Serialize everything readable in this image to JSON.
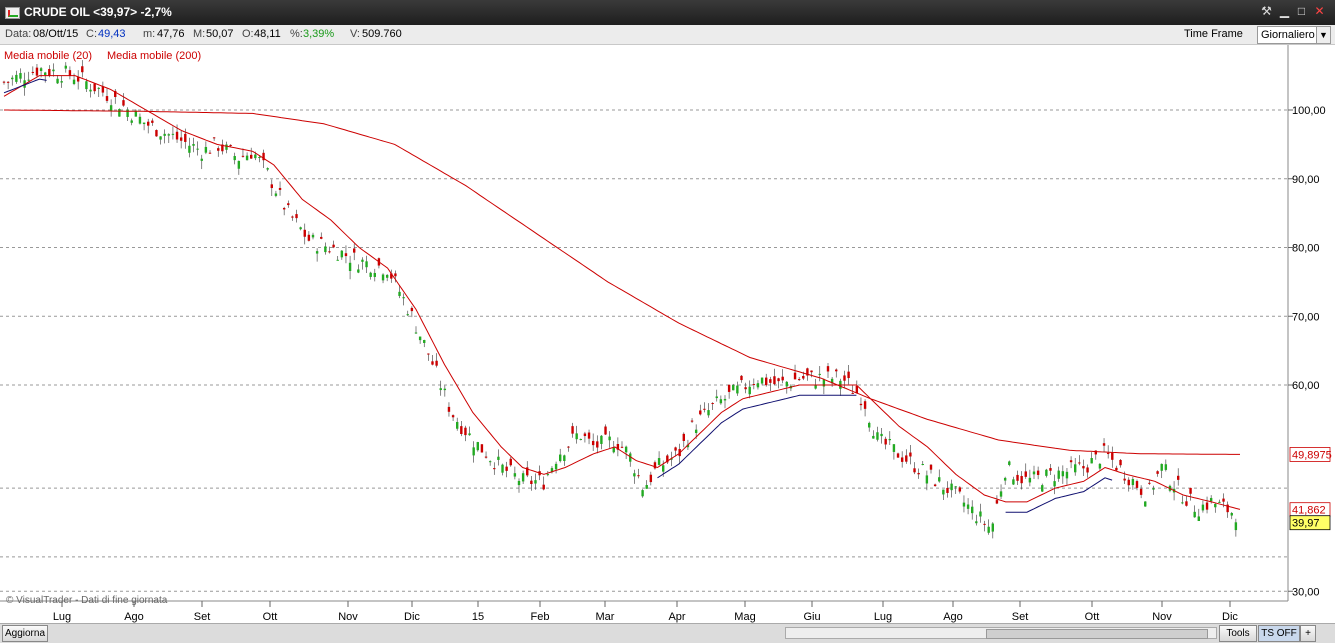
{
  "window": {
    "title": "CRUDE OIL <39,97> -2,7%",
    "controls": {
      "tools": "⚒",
      "minimize": "▁",
      "maximize": "□",
      "close": "✕"
    }
  },
  "infobar": {
    "date_label": "Data:",
    "date": "08/Ott/15",
    "close_label": "C:",
    "close": "49,43",
    "min_label": "m:",
    "min": "47,76",
    "max_label": "M:",
    "max": "50,07",
    "open_label": "O:",
    "open": "48,11",
    "pct_label": "%:",
    "pct": "3,39%",
    "vol_label": "V:",
    "vol": "509.760",
    "timeframe_label": "Time Frame",
    "timeframe_value": "Giornaliero"
  },
  "legend": {
    "ma20": "Media mobile (20)",
    "ma200": "Media mobile (200)"
  },
  "watermark": "© VisualTrader - Dati di fine giornata",
  "price_badges": {
    "ma200": "49,8975",
    "ma20": "41,862",
    "last": "39,97"
  },
  "colors": {
    "ma20": "#cc0000",
    "ma200": "#cc0000",
    "up": "#22aa22",
    "down": "#cc0000",
    "last_badge": "#ffff66"
  },
  "bottombar": {
    "update": "Aggiorna",
    "tools": "Tools",
    "ts": "TS OFF",
    "plus": "+"
  },
  "chart_data": {
    "type": "candlestick",
    "y_ticks": [
      "100,00",
      "90,00",
      "80,00",
      "70,00",
      "60,00",
      "30,00"
    ],
    "x_labels": [
      "Lug",
      "Ago",
      "Set",
      "Ott",
      "Nov",
      "Dic",
      "15",
      "Feb",
      "Mar",
      "Apr",
      "Mag",
      "Giu",
      "Lug",
      "Ago",
      "Set",
      "Ott",
      "Nov",
      "Dic"
    ],
    "ylim": [
      28,
      109
    ],
    "price_path": [
      [
        0,
        104
      ],
      [
        5,
        106
      ],
      [
        10,
        105
      ],
      [
        15,
        102
      ],
      [
        20,
        98
      ],
      [
        24,
        96
      ],
      [
        28,
        94
      ],
      [
        30,
        95
      ],
      [
        33,
        93
      ],
      [
        35,
        94
      ],
      [
        37,
        91
      ],
      [
        40,
        85
      ],
      [
        43,
        81
      ],
      [
        46,
        80
      ],
      [
        48,
        79
      ],
      [
        50,
        78
      ],
      [
        54,
        77
      ],
      [
        57,
        71
      ],
      [
        60,
        64
      ],
      [
        63,
        56
      ],
      [
        66,
        52
      ],
      [
        70,
        48
      ],
      [
        73,
        46
      ],
      [
        76,
        46
      ],
      [
        78,
        50
      ],
      [
        81,
        53
      ],
      [
        83,
        51
      ],
      [
        86,
        52
      ],
      [
        88,
        50
      ],
      [
        90,
        45
      ],
      [
        92,
        48
      ],
      [
        95,
        50
      ],
      [
        97,
        54
      ],
      [
        100,
        57
      ],
      [
        103,
        59
      ],
      [
        106,
        61
      ],
      [
        109,
        60
      ],
      [
        112,
        61
      ],
      [
        115,
        61
      ],
      [
        118,
        61
      ],
      [
        121,
        58
      ],
      [
        123,
        52
      ],
      [
        126,
        50
      ],
      [
        130,
        47
      ],
      [
        134,
        44
      ],
      [
        138,
        40
      ],
      [
        139,
        39
      ],
      [
        141,
        48
      ],
      [
        144,
        46
      ],
      [
        148,
        47
      ],
      [
        152,
        48
      ],
      [
        155,
        50
      ],
      [
        158,
        47
      ],
      [
        161,
        44
      ],
      [
        163,
        48
      ],
      [
        166,
        44
      ],
      [
        168,
        42
      ],
      [
        170,
        43
      ],
      [
        172,
        42
      ],
      [
        174,
        41
      ]
    ],
    "ma20_path": [
      [
        0,
        102
      ],
      [
        5,
        105
      ],
      [
        10,
        105
      ],
      [
        15,
        103
      ],
      [
        20,
        100
      ],
      [
        25,
        97
      ],
      [
        30,
        95
      ],
      [
        35,
        94
      ],
      [
        38,
        92
      ],
      [
        42,
        87
      ],
      [
        46,
        84
      ],
      [
        50,
        80
      ],
      [
        54,
        77
      ],
      [
        58,
        71
      ],
      [
        62,
        63
      ],
      [
        66,
        56
      ],
      [
        70,
        51
      ],
      [
        73,
        48
      ],
      [
        76,
        47
      ],
      [
        79,
        48
      ],
      [
        83,
        50
      ],
      [
        86,
        51
      ],
      [
        89,
        49
      ],
      [
        92,
        48
      ],
      [
        95,
        50
      ],
      [
        98,
        53
      ],
      [
        101,
        56
      ],
      [
        104,
        58
      ],
      [
        108,
        59
      ],
      [
        112,
        60
      ],
      [
        116,
        60
      ],
      [
        120,
        60
      ],
      [
        123,
        57
      ],
      [
        126,
        54
      ],
      [
        130,
        51
      ],
      [
        134,
        47
      ],
      [
        138,
        44
      ],
      [
        141,
        43
      ],
      [
        144,
        43
      ],
      [
        148,
        45
      ],
      [
        152,
        46
      ],
      [
        155,
        48
      ],
      [
        158,
        47
      ],
      [
        162,
        46
      ],
      [
        166,
        44
      ],
      [
        170,
        43
      ],
      [
        174,
        41.9
      ]
    ],
    "ma200_path": [
      [
        0,
        100
      ],
      [
        20,
        99.8
      ],
      [
        35,
        99.5
      ],
      [
        45,
        98
      ],
      [
        55,
        95
      ],
      [
        65,
        89
      ],
      [
        75,
        82
      ],
      [
        85,
        75
      ],
      [
        95,
        69
      ],
      [
        105,
        64
      ],
      [
        115,
        61
      ],
      [
        122,
        58
      ],
      [
        130,
        55
      ],
      [
        140,
        52
      ],
      [
        150,
        50.5
      ],
      [
        160,
        50
      ],
      [
        174,
        49.9
      ]
    ]
  }
}
